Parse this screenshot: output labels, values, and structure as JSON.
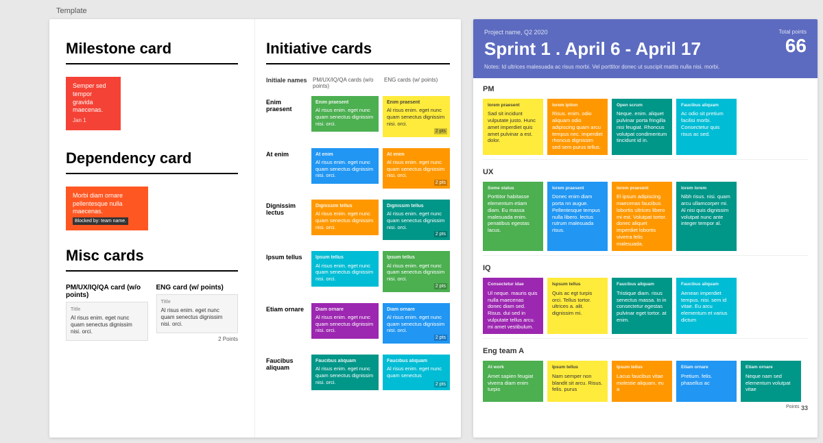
{
  "template_label": "Template",
  "left_panel": {
    "milestone": {
      "title": "Milestone card",
      "card_text": "Semper sed tempor gravida maecenas.",
      "card_label": "Jan 1"
    },
    "dependency": {
      "title": "Dependency card",
      "card_text": "Morbi diam ornare pellentesque nulla maecenas.",
      "blocked_label": "Blocked by: team name."
    },
    "misc": {
      "title": "Misc cards",
      "col1_header": "PM/UX/IQ/QA card (w/o points)",
      "col2_header": "ENG card (w/ points)",
      "card_title": "Title",
      "card_text": "Al risus enim. eget nunc quam senectus dignissim nisi. orci.",
      "points_label": "2 Points"
    }
  },
  "initiative_panel": {
    "title": "Initiative cards",
    "col1_header": "PM/UX/IQ/QA cards (w/o points)",
    "col2_header": "ENG cards (w/ points)",
    "col0_header": "Initiale names",
    "rows": [
      {
        "label": "Enim praesent",
        "card1_label": "Enim praesent",
        "card1_text": "Al risus enim. eget nunc quam senectus dignissim nisi. orci.",
        "card2_label": "Enim praesent",
        "card2_text": "Al risus enim. eget nunc quam senectus dignissim nisi. orci.",
        "card2_points": "2"
      },
      {
        "label": "At enim",
        "card1_label": "At enim",
        "card1_text": "Al risus enim. eget nunc quam senectus dignissim nisi. orci.",
        "card2_label": "At enim",
        "card2_text": "Al risus enim. eget nunc quam senectus dignissim nisi. orci.",
        "card2_points": "2"
      },
      {
        "label": "Dignissim lectus",
        "card1_label": "Dignissim tellus",
        "card1_text": "Al risus enim. eget nunc quam senectus dignissim nisi. orci.",
        "card2_label": "Dignissim tellus",
        "card2_text": "Al risus enim. eget nunc quam senectus dignissim nisi. orci.",
        "card2_points": "2"
      },
      {
        "label": "Ipsum tellus",
        "card1_label": "Ipsum tellus",
        "card1_text": "Al risus enim. eget nunc quam senectus dignissim nisi. orci.",
        "card2_label": "Ipsum tellus",
        "card2_text": "Al risus enim. eget nunc quam senectus dignissim nisi. orci.",
        "card2_points": "2"
      },
      {
        "label": "Etiam ornare",
        "card1_label": "Diam ornare",
        "card1_text": "Al risus enim. eget nunc quam senectus dignissim nisi. orci.",
        "card2_label": "Diam ornare",
        "card2_text": "Al risus enim. eget nunc quam senectus dignissim nisi. orci.",
        "card2_points": "2"
      },
      {
        "label": "Faucibus aliquam",
        "card1_label": "Faucibus aliquam",
        "card1_text": "Al risus enim. eget nunc quam senectus dignissim nisi. orci.",
        "card2_label": "Faucibus aliquam",
        "card2_text": "Al risus enim. eget nunc quam senectus",
        "card2_points": "2"
      }
    ]
  },
  "sprint": {
    "project_name": "Project name, Q2 2020",
    "title": "Sprint 1 . April 6 - April 17",
    "notes": "Notes: Id ultrices malesuada ac risus morbi. Vel porttitor donec ut suscipit mattis nulla nisi. morbi.",
    "total_points_label": "Total points",
    "total_points": "66",
    "teams": [
      {
        "name": "PM",
        "points": null,
        "cards": [
          {
            "status": "lorem praesent",
            "text": "Sad sit incidunt vulputate justo. Hunc amet imperdiet quis amet pulvinar a est. dolor.",
            "color": "c-yellow"
          },
          {
            "status": "lorem iption",
            "text": "Risus. enim. odio aliquam odio adipiscing quam arcu tempus nec. imperdiet rhoncus dignissim sed sem purus tellus.",
            "color": "c-orange"
          },
          {
            "status": "Open scrum",
            "text": "Neque. enim. aliquet pulvinar porta fringilla nisi feugiat. Rhoncus volutpat condimentum tincidunt id in.",
            "color": "c-teal"
          },
          {
            "status": "Faucibus aliquam",
            "text": "Ac odio sit pretium facilisi morbi. Consectetur quis risus ac sed.",
            "color": "c-cyan"
          }
        ]
      },
      {
        "name": "UX",
        "points": null,
        "cards": [
          {
            "status": "Some status",
            "text": "Porttitor habitasse elementum etiam diam. Eu massa malesuada enim. penatibus egestas lacus.",
            "color": "c-green"
          },
          {
            "status": "lorem praesent",
            "text": "Donec enim diam porta nn augue. Pellentesque tempus nulla libero. lectus rutrum malesuada risus.",
            "color": "c-blue"
          },
          {
            "status": "lorem praesent",
            "text": "El ipsum adipiscing maecenas faucibus lobortis ultrices libero mi est. Volutpat tortor. donec aliquet imperdiet lobortis viverra felis malesuada.",
            "color": "c-orange"
          },
          {
            "status": "lorem lorem",
            "text": "Nibh risus. nisi. quam arcu ullamcorper mi. Al nisi quis dignissim volutpat nunc ante integer tempor al.",
            "color": "c-teal"
          }
        ]
      },
      {
        "name": "IQ",
        "points": null,
        "cards": [
          {
            "status": "Consectetur idae",
            "text": "Ul neque. mauris quis nulla maecenas donec diam sed. Risus. dui sed in vulputate tellus arcu. mi amet vestibulum.",
            "color": "c-purple"
          },
          {
            "status": "Ispsum tellus",
            "text": "Quis ac egt turpis orci. Tellus tortor. ultrices a. alit. dignissim mi.",
            "color": "c-yellow"
          },
          {
            "status": "Faucibus aliquam",
            "text": "Tristique diam. risus senectus massa. In in consectetur egestas pulvinar eget tortor. at enim.",
            "color": "c-teal"
          },
          {
            "status": "Faucibus aliquam",
            "text": "Aenean imperdiet tempus. nisi. sem id vitae. Eu arcu elementum et varius dictum",
            "color": "c-cyan"
          }
        ]
      },
      {
        "name": "Eng team A",
        "points": "33",
        "cards": [
          {
            "status": "At work",
            "text": "Amet sapien feugiat viverra diam enim turpis",
            "color": "c-green"
          },
          {
            "status": "Ipsum tellus",
            "text": "Nam semper non blandit sit arcu. Risus. felis. purus",
            "color": "c-yellow"
          },
          {
            "status": "Ipsum tellus",
            "text": "Lacus faucibus vitae molestie aliquam. eu a",
            "color": "c-orange"
          },
          {
            "status": "Etiam ornare",
            "text": "Pretium. felis. phasellus ac",
            "color": "c-blue"
          },
          {
            "status": "Etiam ornare",
            "text": "Neque nam sed elementum volutpat vitae",
            "color": "c-teal"
          }
        ]
      }
    ]
  }
}
